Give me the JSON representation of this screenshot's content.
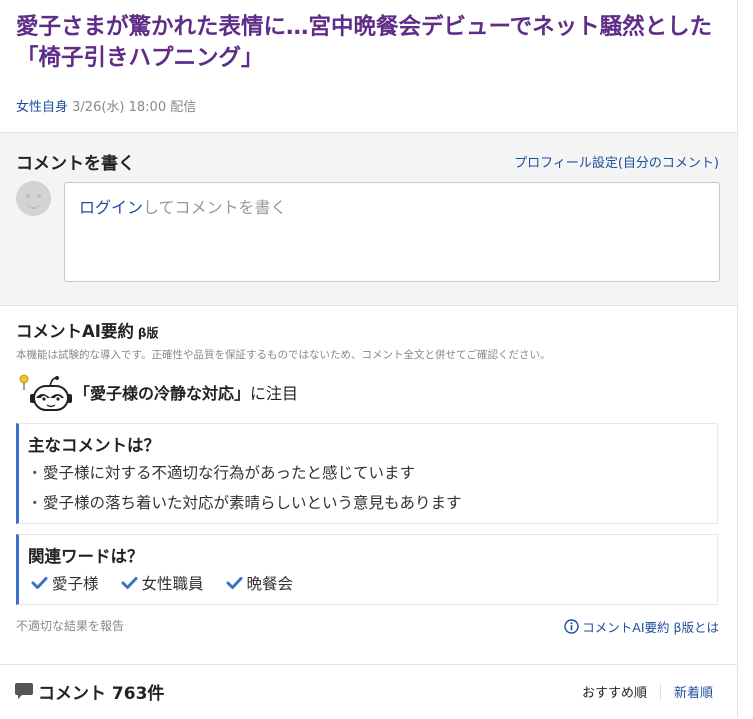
{
  "article": {
    "title": "愛子さまが驚かれた表情に…宮中晩餐会デビューでネット騒然とした「椅子引きハプニング」",
    "source": "女性自身",
    "datetime": "3/26(水) 18:00 配信"
  },
  "compose": {
    "heading": "コメントを書く",
    "profile_link": "プロフィール設定(自分のコメント)",
    "login_label": "ログイン",
    "prompt_suffix": "してコメントを書く"
  },
  "ai_summary": {
    "title": "コメントAI要約",
    "beta": "β版",
    "note": "本機能は試験的な導入です。正確性や品質を保証するものではないため、コメント全文と併せてご確認ください。",
    "focus_topic": "「愛子様の冷静な対応」",
    "focus_suffix": "に注目",
    "main_heading": "主なコメントは？",
    "main_points": [
      "愛子様に対する不適切な行為があったと感じています",
      "愛子様の落ち着いた対応が素晴らしいという意見もあります"
    ],
    "words_heading": "関連ワードは？",
    "words": [
      "愛子様",
      "女性職員",
      "晩餐会"
    ],
    "report_link": "不適切な結果を報告",
    "about_link": "コメントAI要約 β版とは"
  },
  "comments": {
    "count_label": "コメント 763件",
    "sort_recommended": "おすすめ順",
    "sort_newest": "新着順"
  },
  "colors": {
    "title": "#5f2c87",
    "link": "#1e4e9c",
    "accent_check": "#3a73c6"
  },
  "icons": {
    "avatar": "default-avatar-icon",
    "robot": "ai-robot-icon",
    "check": "check-icon",
    "info": "info-icon",
    "comment": "comment-bubble-icon"
  }
}
